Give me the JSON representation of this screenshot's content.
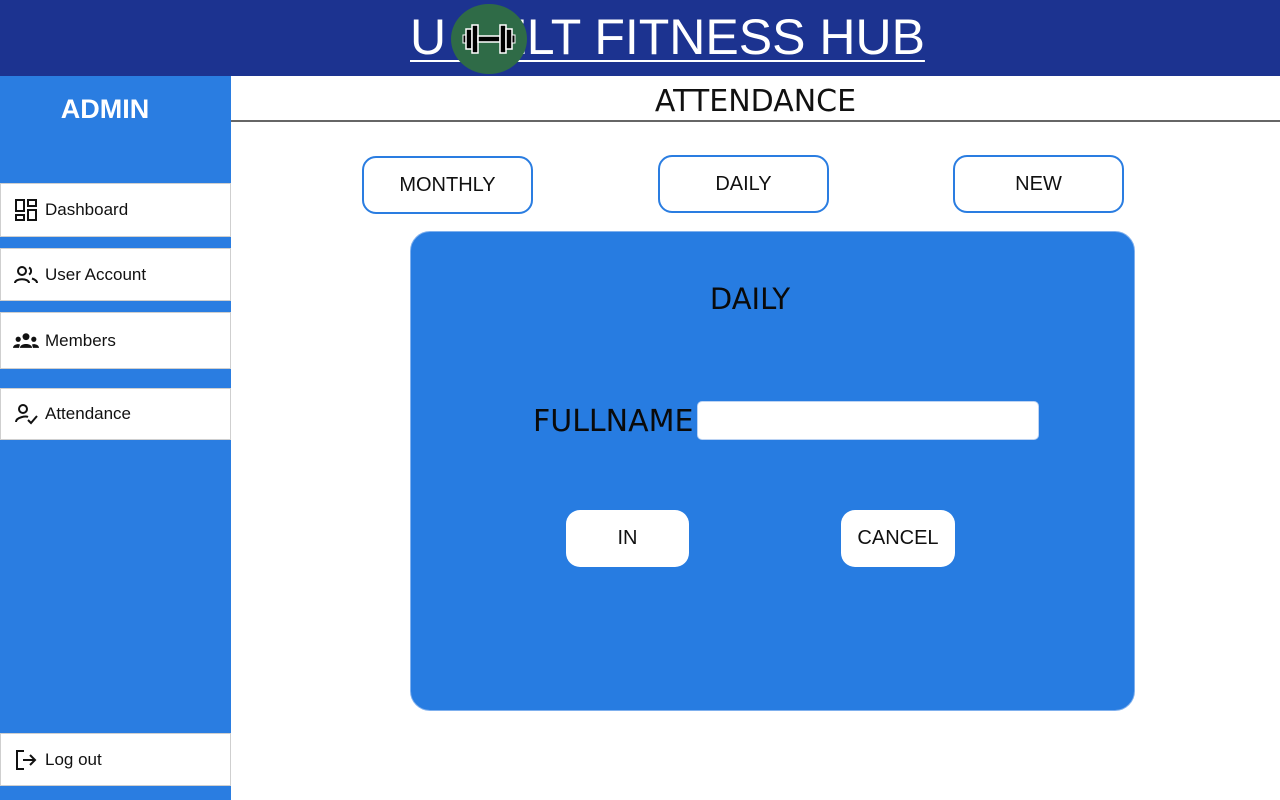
{
  "header": {
    "title": "U        BELT FITNESS HUB",
    "logo_icon": "dumbbell-icon"
  },
  "sidebar": {
    "role": "ADMIN",
    "items": [
      {
        "label": "Dashboard",
        "icon": "dashboard-icon"
      },
      {
        "label": "User Account",
        "icon": "user-account-icon"
      },
      {
        "label": "Members",
        "icon": "members-icon"
      },
      {
        "label": "Attendance",
        "icon": "attendance-icon"
      }
    ],
    "logout": {
      "label": "Log out",
      "icon": "logout-icon"
    }
  },
  "main": {
    "title": "ATTENDANCE",
    "tabs": [
      {
        "label": "MONTHLY"
      },
      {
        "label": "DAILY"
      },
      {
        "label": "NEW"
      }
    ],
    "panel": {
      "title": "DAILY",
      "field_label": "FULLNAME:",
      "field_value": "",
      "in_label": "IN",
      "cancel_label": "CANCEL"
    }
  },
  "colors": {
    "header_bg": "#1c3390",
    "sidebar_bg": "#2a7de1",
    "panel_bg": "#277ce1",
    "logo_bg": "#2f6b47"
  }
}
